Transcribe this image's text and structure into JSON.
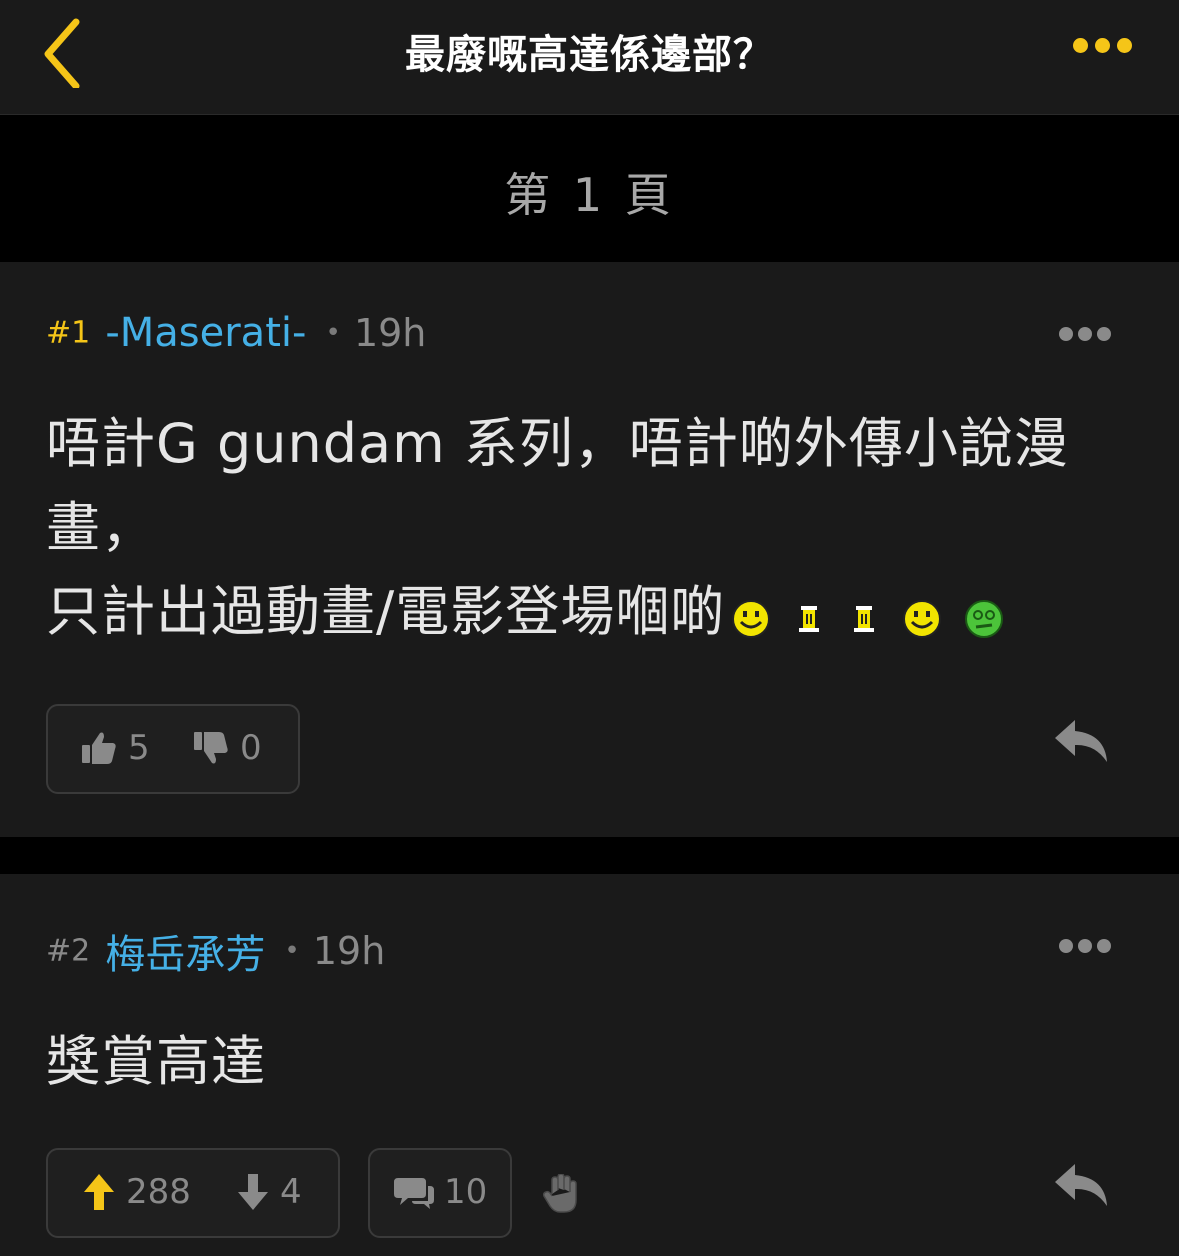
{
  "header": {
    "title": "最廢嘅高達係邊部？"
  },
  "page_banner": {
    "label": "第 1 頁"
  },
  "posts": [
    {
      "floor": "#1",
      "username": "-Maserati-",
      "separator": "•",
      "time": "19h",
      "content_line1": "唔計G gundam 系列，唔計啲外傳小說漫",
      "content_line2": "畫，",
      "content_line3": "只計出過動畫/電影登場嗰啲",
      "likes": "5",
      "dislikes": "0",
      "colors": {
        "floor": "#f5c518",
        "username": "#45b0e6"
      }
    },
    {
      "floor": "#2",
      "username": "梅岳承芳",
      "separator": "•",
      "time": "19h",
      "content": "獎賞高達",
      "upvotes": "288",
      "downvotes": "4",
      "comments": "10",
      "colors": {
        "floor": "#8a8a8a",
        "username": "#45b0e6",
        "upvote_arrow": "#f5c518"
      }
    }
  ],
  "icons": [
    "back-chevron-icon",
    "more-dots-icon",
    "thumbs-up-icon",
    "thumbs-down-icon",
    "reply-icon",
    "arrow-up-icon",
    "arrow-down-icon",
    "comment-icon",
    "clap-hand-icon",
    "smiley-emoji-icon",
    "tower-emoji-icon"
  ],
  "accent_color": "#f5c518"
}
